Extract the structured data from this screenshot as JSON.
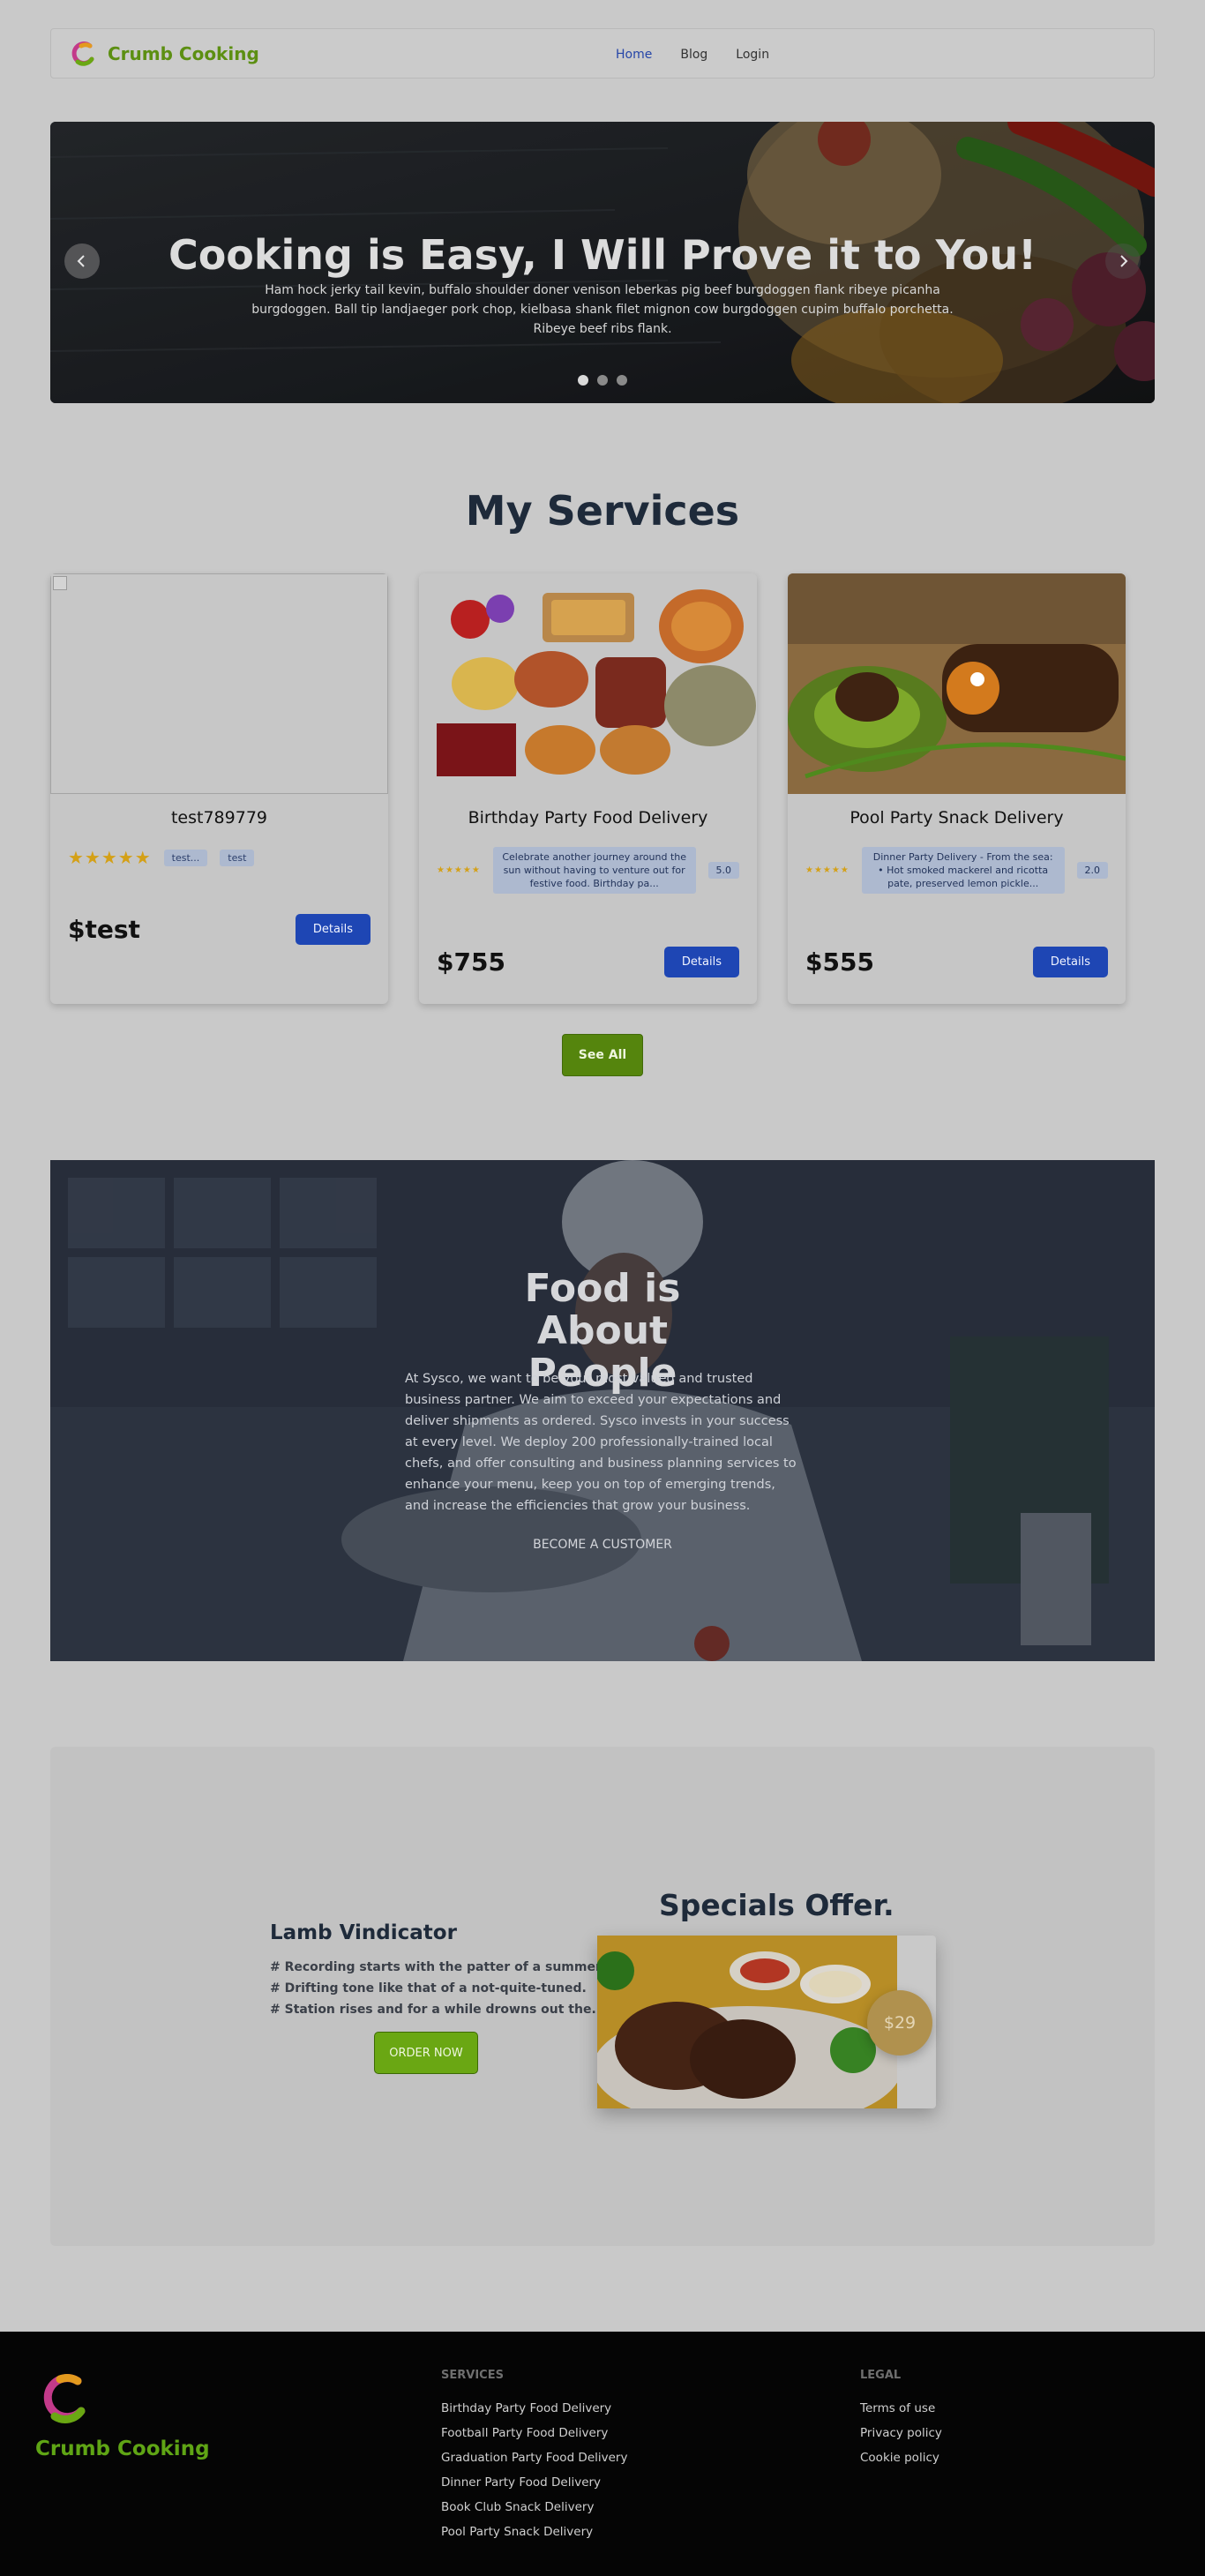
{
  "navbar": {
    "brand": "Crumb Cooking",
    "links": [
      "Home",
      "Blog",
      "Login"
    ]
  },
  "hero": {
    "title": "Cooking is Easy, I Will Prove it to You!",
    "subtitle": "Ham hock jerky tail kevin, buffalo shoulder doner venison leberkas pig beef burgdoggen flank ribeye picanha burgdoggen. Ball tip landjaeger pork chop, kielbasa shank filet mignon cow burgdoggen cupim buffalo porchetta. Ribeye beef ribs flank.",
    "prev_icon": "chevron-left-icon",
    "next_icon": "chevron-right-icon",
    "slides": 3,
    "active_slide": 1
  },
  "services": {
    "title": "My Services",
    "cards": [
      {
        "name": "test789779",
        "stars": "★★★★★",
        "tags": [
          "test...",
          "test"
        ],
        "price": "$test",
        "button": "Details"
      },
      {
        "name": "Birthday Party Food Delivery",
        "stars": "★★★★★",
        "description": "Celebrate another journey around the sun without having to venture out for festive food. Birthday pa...",
        "rating": "5.0",
        "price": "$755",
        "button": "Details"
      },
      {
        "name": "Pool Party Snack Delivery",
        "stars": "★★★★★",
        "description": "Dinner Party Delivery - From the sea: • Hot smoked mackerel and ricotta pate, preserved lemon pickle...",
        "rating": "2.0",
        "price": "$555",
        "button": "Details"
      }
    ],
    "see_all": "See All"
  },
  "people": {
    "title": "Food is About People",
    "body": "At Sysco, we want to be your most valued and trusted business partner. We aim to exceed your expectations and deliver shipments as ordered. Sysco invests in your success at every level. We deploy 200 professionally-trained local chefs, and offer consulting and business planning services to enhance your menu, keep you on top of emerging trends, and increase the efficiencies that grow your business.",
    "link": "BECOME A CUSTOMER"
  },
  "specials": {
    "title": "Specials Offer.",
    "dish": "Lamb Vindicator",
    "lines": [
      "# Recording starts with the patter of a summer.",
      "# Drifting tone like that of a not-quite-tuned.",
      "# Station rises and for a while drowns out the."
    ],
    "order_button": "ORDER NOW",
    "price": "$29"
  },
  "footer": {
    "brand": "Crumb Cooking",
    "services_heading": "SERVICES",
    "services": [
      "Birthday Party Food Delivery",
      "Football Party Food Delivery",
      "Graduation Party Food Delivery",
      "Dinner Party Food Delivery",
      "Book Club Snack Delivery",
      "Pool Party Snack Delivery"
    ],
    "legal_heading": "LEGAL",
    "legal": [
      "Terms of use",
      "Privacy policy",
      "Cookie policy"
    ]
  },
  "colors": {
    "brand_green": "#5c8f12",
    "primary_blue": "#1e46b4",
    "page_bg": "#c9c9c9",
    "footer_bg": "#050505"
  }
}
